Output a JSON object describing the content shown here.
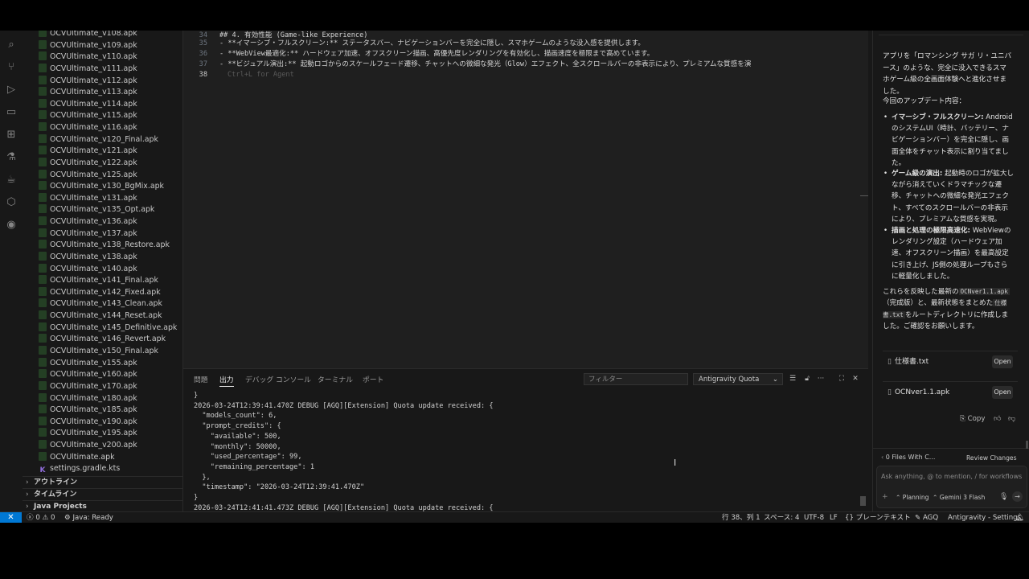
{
  "explorer": {
    "files": [
      "OCVUltimate_v108.apk",
      "OCVUltimate_v109.apk",
      "OCVUltimate_v110.apk",
      "OCVUltimate_v111.apk",
      "OCVUltimate_v112.apk",
      "OCVUltimate_v113.apk",
      "OCVUltimate_v114.apk",
      "OCVUltimate_v115.apk",
      "OCVUltimate_v116.apk",
      "OCVUltimate_v120_Final.apk",
      "OCVUltimate_v121.apk",
      "OCVUltimate_v122.apk",
      "OCVUltimate_v125.apk",
      "OCVUltimate_v130_BgMix.apk",
      "OCVUltimate_v131.apk",
      "OCVUltimate_v135_Opt.apk",
      "OCVUltimate_v136.apk",
      "OCVUltimate_v137.apk",
      "OCVUltimate_v138_Restore.apk",
      "OCVUltimate_v138.apk",
      "OCVUltimate_v140.apk",
      "OCVUltimate_v141_Final.apk",
      "OCVUltimate_v142_Fixed.apk",
      "OCVUltimate_v143_Clean.apk",
      "OCVUltimate_v144_Reset.apk",
      "OCVUltimate_v145_Definitive.apk",
      "OCVUltimate_v146_Revert.apk",
      "OCVUltimate_v150_Final.apk",
      "OCVUltimate_v155.apk",
      "OCVUltimate_v160.apk",
      "OCVUltimate_v170.apk",
      "OCVUltimate_v180.apk",
      "OCVUltimate_v185.apk",
      "OCVUltimate_v190.apk",
      "OCVUltimate_v195.apk",
      "OCVUltimate_v200.apk",
      "OCVUltimate.apk",
      "settings.gradle.kts"
    ],
    "sections": [
      "アウトライン",
      "タイムライン",
      "Java Projects"
    ]
  },
  "editor": {
    "lines": [
      {
        "num": "34",
        "text": "## 4. 有効性能 (Game-like Experience)"
      },
      {
        "num": "35",
        "text": "- **イマーシブ・フルスクリーン:** ステータスバー、ナビゲーションバーを完全に隠し、スマホゲームのような没入感を提供します。"
      },
      {
        "num": "36",
        "text": "- **WebView最適化:** ハードウェア加速、オフスクリーン描画、高優先度レンダリングを有効化し、描画速度を極限まで高めています。"
      },
      {
        "num": "37",
        "text": "- **ビジュアル演出:** 起動ロゴからのスケールフェード遷移、チャットへの微細な発光（Glow）エフェクト、全スクロールバーの非表示により、プレミアムな質感を演"
      },
      {
        "num": "38",
        "text": "Ctrl+L for Agent"
      }
    ]
  },
  "panel": {
    "tabs": [
      "問題",
      "出力",
      "デバッグ コンソール",
      "ターミナル",
      "ポート"
    ],
    "filter_placeholder": "フィルター",
    "output_channel": "Antigravity Quota",
    "output_lines": [
      "}",
      "2026-03-24T12:39:41.470Z DEBUG [AGQ][Extension] Quota update received: {",
      "  \"models_count\": 6,",
      "  \"prompt_credits\": {",
      "    \"available\": 500,",
      "    \"monthly\": 50000,",
      "    \"used_percentage\": 99,",
      "    \"remaining_percentage\": 1",
      "  },",
      "  \"timestamp\": \"2026-03-24T12:39:41.470Z\"",
      "}",
      "2026-03-24T12:41:41.473Z DEBUG [AGQ][Extension] Quota update received: {"
    ]
  },
  "chat": {
    "intro": "アプリを「ロマンシング サガ リ・ユニバース」のような、完全に没入できるスマホゲーム級の全画面体験へと進化させました。",
    "update_heading": "今回のアップデート内容：",
    "bullets": [
      {
        "bold": "イマーシブ・フルスクリーン:",
        "text": " AndroidのシステムUI（時計、バッテリー、ナビゲーションバー）を完全に隠し、画面全体をチャット表示に割り当てました。"
      },
      {
        "bold": "ゲーム級の演出:",
        "text": " 起動時のロゴが拡大しながら消えていくドラマチックな遷移、チャットへの微細な発光エフェクト、すべてのスクロールバーの非表示により、プレミアムな質感を実現。"
      },
      {
        "bold": "描画と処理の極限高速化:",
        "text": " WebViewのレンダリング設定（ハードウェア加速、オフスクリーン描画）を最高設定に引き上げ、JS側の処理ループもさらに軽量化しました。"
      }
    ],
    "closing_a": "これらを反映した最新の",
    "closing_code1": "OCNver1.1.apk",
    "closing_b": "（完成版）と、最新状態をまとめた",
    "closing_code2": "仕様書.txt",
    "closing_c": "をルートディレクトリに作成しました。ご確認をお願いします。",
    "files": [
      {
        "name": "仕様書.txt",
        "button": "Open"
      },
      {
        "name": "OCNver1.1.apk",
        "button": "Open"
      }
    ],
    "copy_label": "Copy",
    "files_changed": "0 Files With C...",
    "review_label": "Review Changes",
    "input_placeholder": "Ask anything, @ to mention, / for workflows",
    "mode_label": "Planning",
    "model_label": "Gemini 3 Flash"
  },
  "statusbar": {
    "errors": "0",
    "warnings": "0",
    "java": "Java: Ready",
    "position": "行 38、列 1",
    "spaces": "スペース: 4",
    "encoding": "UTF-8",
    "eol": "LF",
    "language": "プレーンテキスト",
    "agq": "AGQ",
    "settings": "Antigravity - Settings"
  }
}
